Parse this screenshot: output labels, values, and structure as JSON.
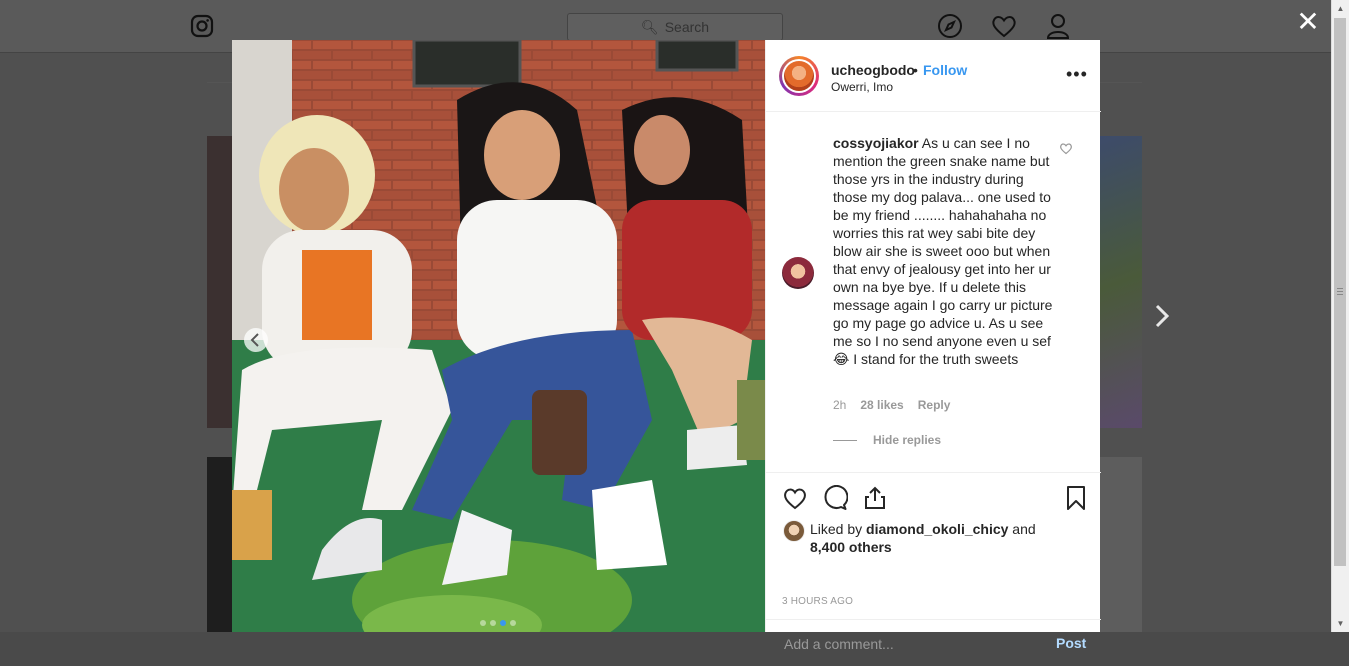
{
  "header": {
    "search_placeholder": "Search"
  },
  "modal": {
    "username": "ucheogbodo",
    "separator": "•",
    "follow_label": "Follow",
    "location": "Owerri, Imo",
    "more_label": "•••",
    "close_label": "✕",
    "carousel": {
      "total": 4,
      "active": 3
    }
  },
  "comment": {
    "author": "cossyojiakor",
    "text": "As u can see I no mention the green snake name but those yrs in the industry during those my dog palava... one used to be my friend ........ hahahahaha no worries this rat wey sabi bite dey blow air she is sweet ooo but when that envy of jealousy get into her ur own na bye bye. If u delete this message again I go carry ur picture go my page go advice u. As u see me so I no send anyone even u sef😂 I stand for the truth sweets",
    "time": "2h",
    "likes": "28 likes",
    "reply_label": "Reply",
    "hide_replies_label": "Hide replies"
  },
  "likes": {
    "prefix": "Liked by ",
    "user": "diamond_okoli_chicy",
    "middle": " and",
    "others": "8,400 others"
  },
  "timestamp": "3 HOURS AGO",
  "add_comment": {
    "placeholder": "Add a comment...",
    "post_label": "Post"
  },
  "colors": {
    "link_blue": "#3897f0",
    "post_disabled": "#b3dbff",
    "text": "#262626",
    "muted": "#999999"
  }
}
